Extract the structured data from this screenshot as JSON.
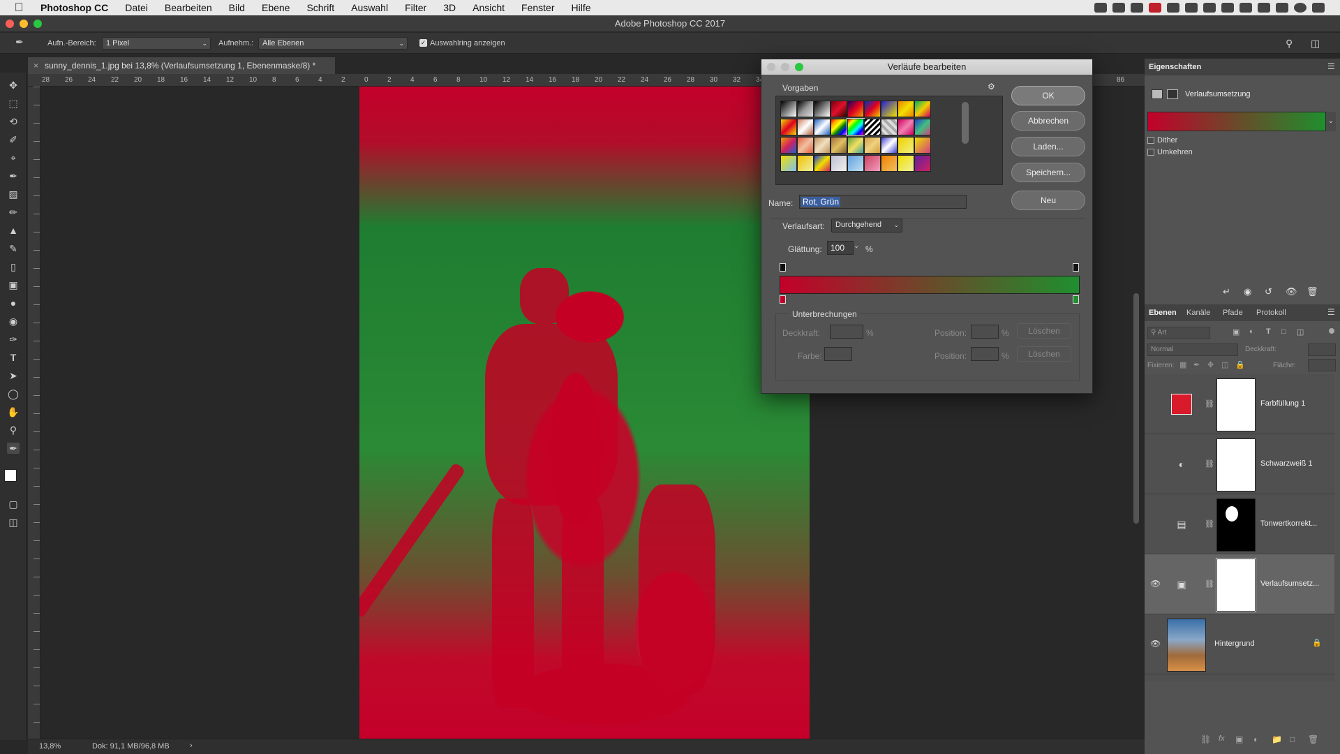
{
  "menubar": {
    "items": [
      "Photoshop CC",
      "Datei",
      "Bearbeiten",
      "Bild",
      "Ebene",
      "Schrift",
      "Auswahl",
      "Filter",
      "3D",
      "Ansicht",
      "Fenster",
      "Hilfe"
    ]
  },
  "app_title": "Adobe Photoshop CC 2017",
  "options_bar": {
    "sample_size_label": "Aufn.-Bereich:",
    "sample_size_value": "1 Pixel",
    "sample_label": "Aufnehm.:",
    "sample_value": "Alle Ebenen",
    "show_ring_label": "Auswahlring anzeigen"
  },
  "document_tab": "sunny_dennis_1.jpg bei 13,8% (Verlaufsumsetzung 1, Ebenenmaske/8) *",
  "ruler_ticks": [
    "28",
    "26",
    "24",
    "22",
    "20",
    "18",
    "16",
    "14",
    "12",
    "10",
    "8",
    "6",
    "4",
    "2",
    "0",
    "2",
    "4",
    "6",
    "8",
    "10",
    "12",
    "14",
    "16",
    "18",
    "20",
    "22",
    "24",
    "26",
    "28",
    "30",
    "32",
    "34",
    "86"
  ],
  "dialog": {
    "title": "Verläufe bearbeiten",
    "presets_label": "Vorgaben",
    "buttons": {
      "ok": "OK",
      "cancel": "Abbrechen",
      "load": "Laden...",
      "save": "Speichern...",
      "new": "Neu"
    },
    "name_label": "Name:",
    "name_value": "Rot, Grün",
    "type_label": "Verlaufsart:",
    "type_value": "Durchgehend",
    "smoothness_label": "Glättung:",
    "smoothness_value": "100",
    "percent": "%",
    "stops_label": "Unterbrechungen",
    "opacity_label": "Deckkraft:",
    "color_label": "Farbe:",
    "position_label": "Position:",
    "delete_label": "Löschen",
    "gradient_colors": {
      "start": "#c4002a",
      "end": "#1f8f2e"
    }
  },
  "properties": {
    "title": "Eigenschaften",
    "adjustment_name": "Verlaufsumsetzung",
    "dither_label": "Dither",
    "reverse_label": "Umkehren"
  },
  "layers_panel": {
    "tabs": [
      "Ebenen",
      "Kanäle",
      "Pfade",
      "Protokoll"
    ],
    "kind_placeholder": "Art",
    "blend_mode": "Normal",
    "opacity_label": "Deckkraft:",
    "lock_label": "Fixieren:",
    "fill_label": "Fläche:",
    "layers": [
      {
        "name": "Farbfüllung 1",
        "visible": false
      },
      {
        "name": "Schwarzweiß 1",
        "visible": false
      },
      {
        "name": "Tonwertkorrekt...",
        "visible": false
      },
      {
        "name": "Verlaufsumsetz...",
        "visible": true
      },
      {
        "name": "Hintergrund",
        "visible": true
      }
    ]
  },
  "status": {
    "zoom": "13,8%",
    "doc_size": "Dok: 91,1 MB/96,8 MB"
  }
}
